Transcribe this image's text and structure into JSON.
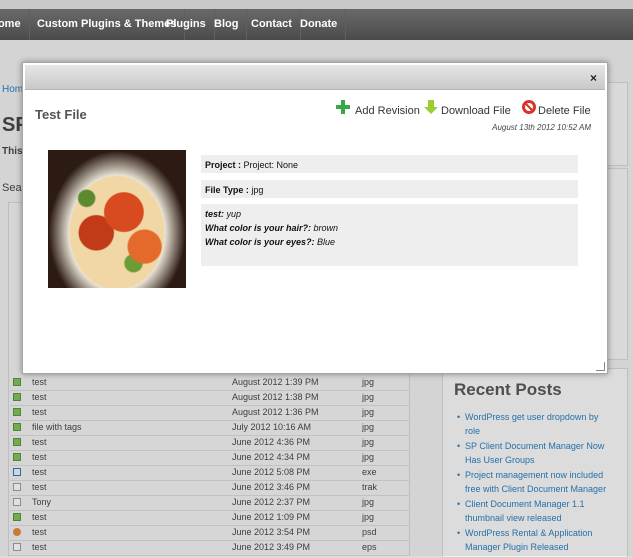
{
  "nav": {
    "items": [
      "Home",
      "Custom Plugins & Themes",
      "Plugins",
      "Blog",
      "Contact",
      "Donate"
    ]
  },
  "background": {
    "breadcrumb": "Home",
    "title": "SP",
    "intro": "This",
    "search_label": "Sear",
    "rows": [
      {
        "name": "test",
        "date": "August 2012 1:39 PM",
        "type": "jpg",
        "icon": "image-icon"
      },
      {
        "name": "test",
        "date": "August 2012 1:38 PM",
        "type": "jpg",
        "icon": "image-icon"
      },
      {
        "name": "test",
        "date": "August 2012 1:36 PM",
        "type": "jpg",
        "icon": "image-icon"
      },
      {
        "name": "file with tags",
        "date": "July 2012 10:16 AM",
        "type": "jpg",
        "icon": "image-icon"
      },
      {
        "name": "test",
        "date": "June 2012 4:36 PM",
        "type": "jpg",
        "icon": "image-icon"
      },
      {
        "name": "test",
        "date": "June 2012 4:34 PM",
        "type": "jpg",
        "icon": "image-icon"
      },
      {
        "name": "test",
        "date": "June 2012 5:08 PM",
        "type": "exe",
        "icon": "window-icon"
      },
      {
        "name": "test",
        "date": "June 2012 3:46 PM",
        "type": "trak",
        "icon": "document-icon"
      },
      {
        "name": "Tony",
        "date": "June 2012 2:37 PM",
        "type": "jpg",
        "icon": "document-icon"
      },
      {
        "name": "test",
        "date": "June 2012 1:09 PM",
        "type": "jpg",
        "icon": "image-icon"
      },
      {
        "name": "test",
        "date": "June 2012 3:54 PM",
        "type": "psd",
        "icon": "photoshop-icon"
      },
      {
        "name": "test",
        "date": "June 2012 3:49 PM",
        "type": "eps",
        "icon": "document-icon"
      }
    ],
    "recent_posts": {
      "title": "Recent Posts",
      "items": [
        "WordPress get user dropdown by role",
        "SP Client Document Manager Now Has User Groups",
        "Project management now included free with Client Document Manager",
        "Client Document Manager 1.1 thumbnail view released",
        "WordPress Rental & Application Manager Plugin Released"
      ]
    }
  },
  "modal": {
    "close": "×",
    "title": "Test File",
    "actions": {
      "add_revision": "Add Revision",
      "download": "Download File",
      "delete": "Delete File"
    },
    "timestamp": "August 13th 2012 10:52 AM",
    "project_label": "Project :",
    "project_value": "Project: None",
    "filetype_label": "File Type :",
    "filetype_value": "jpg",
    "fields": [
      {
        "label": "test:",
        "value": "yup"
      },
      {
        "label": "What color is your hair?:",
        "value": "brown"
      },
      {
        "label": "What color is your eyes?:",
        "value": "Blue"
      }
    ]
  },
  "colors": {
    "link": "#2a7ab8",
    "nav_bg": "#555555",
    "add_green": "#3aa64a",
    "download_green": "#9acd32",
    "delete_red": "#d9332b"
  }
}
